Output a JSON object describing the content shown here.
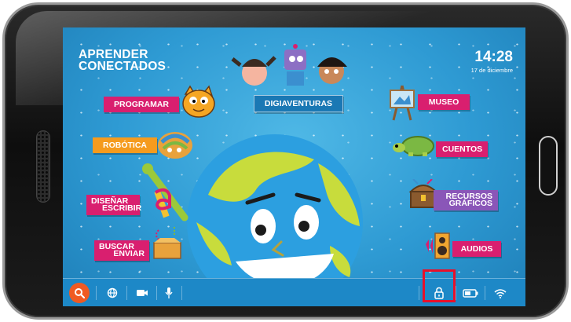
{
  "app": {
    "title_line1": "APRENDER",
    "title_line2": "CONECTADOS"
  },
  "clock": {
    "time": "14:28",
    "date": "17 de diciembre"
  },
  "menu": {
    "programar": "PROGRAMAR",
    "robotica": "ROBÓTICA",
    "disenar_line1": "DISEÑAR",
    "disenar_line2": "ESCRIBIR",
    "buscar_line1": "BUSCAR",
    "buscar_line2": "ENVIAR",
    "digiaventuras": "DIGIAVENTURAS",
    "museo": "MUSEO",
    "cuentos": "CUENTOS",
    "recursos_line1": "RECURSOS",
    "recursos_line2": "GRÁFICOS",
    "audios": "AUDIOS"
  },
  "taskbar": {
    "left_icons": [
      "search-icon",
      "globe-icon",
      "video-camera-icon",
      "microphone-icon"
    ],
    "right_icons": [
      "lock-icon",
      "battery-icon",
      "wifi-icon"
    ]
  },
  "colors": {
    "screen_bg": "#2e9ad3",
    "taskbar_bg": "#1d88c7",
    "magenta_label": "#d91f6f",
    "orange_label": "#f59b1e",
    "purple_label": "#8a56b8",
    "search_button": "#f05a22",
    "highlight": "#e8102a"
  }
}
